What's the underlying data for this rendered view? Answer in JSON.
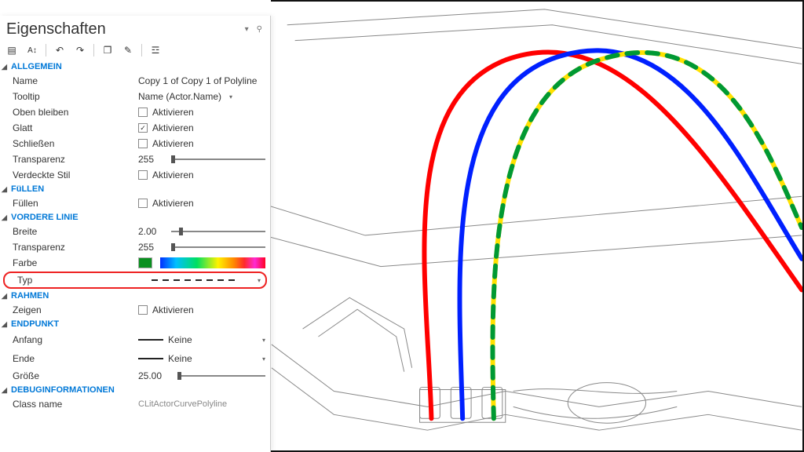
{
  "panel": {
    "title": "Eigenschaften",
    "sections": {
      "allgemein": {
        "header": "ALLGEMEIN",
        "name_label": "Name",
        "name_value": "Copy 1 of Copy 1 of Polyline",
        "tooltip_label": "Tooltip",
        "tooltip_value": "Name (Actor.Name)",
        "oben_label": "Oben bleiben",
        "glatt_label": "Glatt",
        "schliessen_label": "Schließen",
        "transparenz_label": "Transparenz",
        "transparenz_value": "255",
        "verdeckte_label": "Verdeckte Stil",
        "aktivieren": "Aktivieren"
      },
      "fuellen": {
        "header": "FüLLEN",
        "fuellen_label": "Füllen",
        "aktivieren": "Aktivieren"
      },
      "vordere": {
        "header": "VORDERE LINIE",
        "breite_label": "Breite",
        "breite_value": "2.00",
        "transparenz_label": "Transparenz",
        "transparenz_value": "255",
        "farbe_label": "Farbe",
        "typ_label": "Typ"
      },
      "rahmen": {
        "header": "RAHMEN",
        "zeigen_label": "Zeigen",
        "aktivieren": "Aktivieren"
      },
      "endpunkt": {
        "header": "ENDPUNKT",
        "anfang_label": "Anfang",
        "anfang_value": "Keine",
        "ende_label": "Ende",
        "ende_value": "Keine",
        "groesse_label": "Größe",
        "groesse_value": "25.00"
      },
      "debug": {
        "header": "DEBUGINFORMATIONEN",
        "classname_label": "Class name",
        "classname_value": "CLitActorCurvePolyline"
      }
    },
    "colors": {
      "accent": "#0078d7",
      "highlight": "#e22"
    }
  },
  "canvas": {
    "red_line": "#ff0000",
    "blue_line": "#0020ff",
    "yellow_line": "#ffe100",
    "green_dash": "#009933"
  }
}
